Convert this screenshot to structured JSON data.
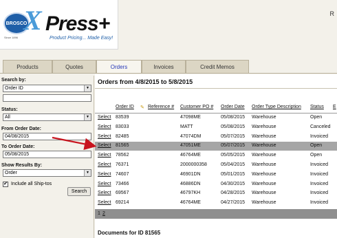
{
  "header": {
    "brand_badge": "BROSCO",
    "brand_badge_sub": "Since 1896",
    "logo_x": "X",
    "logo_word": "Press+",
    "tagline": "Product Pricing... Made Easy!",
    "top_right_text": "R"
  },
  "tabs": [
    {
      "label": "Products"
    },
    {
      "label": "Quotes"
    },
    {
      "label": "Orders"
    },
    {
      "label": "Invoices"
    },
    {
      "label": "Credit Memos"
    }
  ],
  "active_tab": "Orders",
  "search": {
    "search_by_label": "Search by:",
    "search_by_value": "Order ID",
    "search_text_value": "",
    "status_label": "Status:",
    "status_value": "All",
    "from_label": "From Order Date:",
    "from_value": "04/08/2015",
    "to_label": "To Order Date:",
    "to_value": "05/08/2015",
    "show_label": "Show Results By:",
    "show_value": "Order",
    "include_shiptos_label": "Include all Ship-tos",
    "include_shiptos_checked": true,
    "check_glyph": "✔",
    "search_button": "Search"
  },
  "orders": {
    "heading": "Orders from 4/8/2015 to 5/8/2015",
    "columns": [
      "Order ID",
      "Reference #",
      "Customer PO #",
      "Order Date",
      "Order Type Description",
      "Status",
      "E"
    ],
    "sort_glyph": "✎",
    "select_label": "Select",
    "rows": [
      {
        "id": "83539",
        "ref": "",
        "po": "47098ME",
        "date": "05/08/2015",
        "type": "Warehouse",
        "status": "Open"
      },
      {
        "id": "83033",
        "ref": "",
        "po": "MATT",
        "date": "05/08/2015",
        "type": "Warehouse",
        "status": "Canceled"
      },
      {
        "id": "82485",
        "ref": "",
        "po": "47074DM",
        "date": "05/07/2015",
        "type": "Warehouse",
        "status": "Invoiced"
      },
      {
        "id": "81565",
        "ref": "",
        "po": "47051ME",
        "date": "05/07/2015",
        "type": "Warehouse",
        "status": "Open"
      },
      {
        "id": "78562",
        "ref": "",
        "po": "46764ME",
        "date": "05/05/2015",
        "type": "Warehouse",
        "status": "Open"
      },
      {
        "id": "76371",
        "ref": "",
        "po": "2000000358",
        "date": "05/04/2015",
        "type": "Warehouse",
        "status": "Invoiced"
      },
      {
        "id": "74607",
        "ref": "",
        "po": "46901DN",
        "date": "05/01/2015",
        "type": "Warehouse",
        "status": "Invoiced"
      },
      {
        "id": "73466",
        "ref": "",
        "po": "46886DN",
        "date": "04/30/2015",
        "type": "Warehouse",
        "status": "Invoiced"
      },
      {
        "id": "69567",
        "ref": "",
        "po": "46797KH",
        "date": "04/28/2015",
        "type": "Warehouse",
        "status": "Invoiced"
      },
      {
        "id": "69214",
        "ref": "",
        "po": "46764ME",
        "date": "04/27/2015",
        "type": "Warehouse",
        "status": "Invoiced"
      }
    ],
    "highlighted_row_id": "81565",
    "pages": [
      "1",
      "2"
    ],
    "current_page": "1"
  },
  "documents": {
    "heading": "Documents for ID 81565"
  },
  "colors": {
    "accent_blue": "#2436b8",
    "arrow_red": "#c8141e",
    "highlight_row": "#a6a6a6",
    "tab_bg": "#dcd6c4"
  }
}
